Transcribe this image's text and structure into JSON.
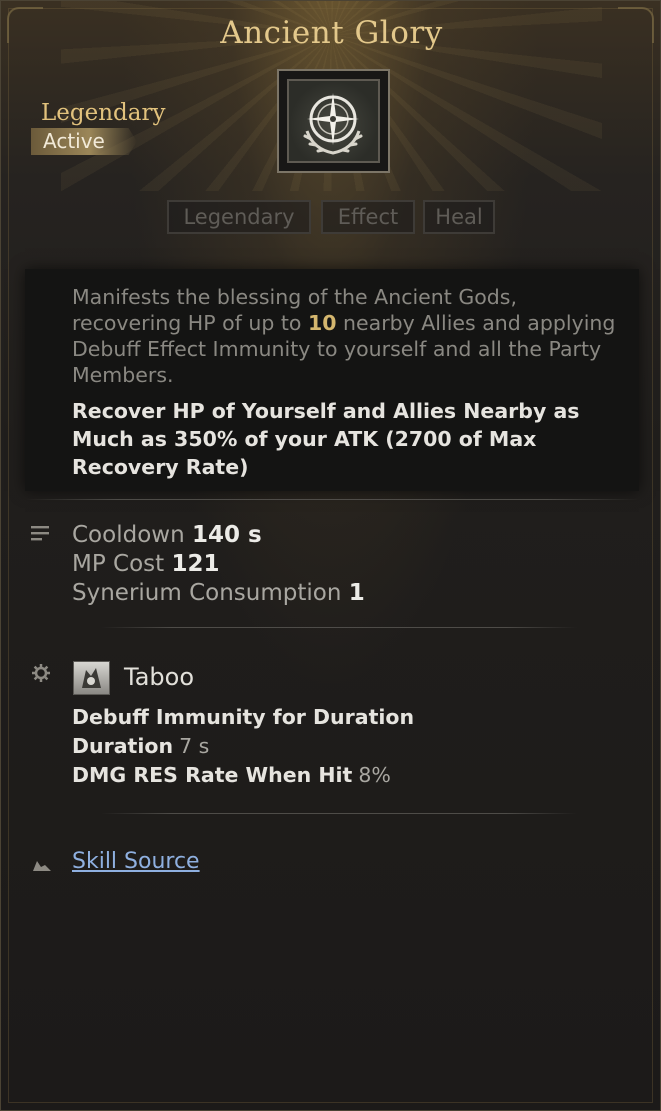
{
  "skill": {
    "name": "Ancient Glory",
    "grade": "Legendary",
    "type": "Active",
    "icon": "compass-laurel-icon"
  },
  "tags": [
    "Legendary",
    "Effect",
    "Heal"
  ],
  "description": {
    "part1": "Manifests the blessing of the Ancient Gods, recovering HP of up to ",
    "highlight": "10",
    "part2": " nearby Allies and applying Debuff Effect Immunity to yourself and all the Party Members.",
    "effect": "Recover HP of Yourself and Allies Nearby as Much as 350% of your ATK (2700 of Max Recovery Rate)"
  },
  "stats": {
    "cooldown_label": "Cooldown",
    "cooldown_value": "140 s",
    "mp_label": "MP Cost",
    "mp_value": "121",
    "synerium_label": "Synerium Consumption",
    "synerium_value": "1"
  },
  "taboo": {
    "title": "Taboo",
    "line1": "Debuff Immunity for Duration",
    "duration_label": "Duration",
    "duration_value": "7 s",
    "dmg_label": "DMG RES Rate When Hit",
    "dmg_value": "8%"
  },
  "source": {
    "label": "Skill Source"
  },
  "colors": {
    "title_gold": "#e3c88b",
    "highlight": "#d4b66e",
    "link": "#8fb0e0"
  }
}
